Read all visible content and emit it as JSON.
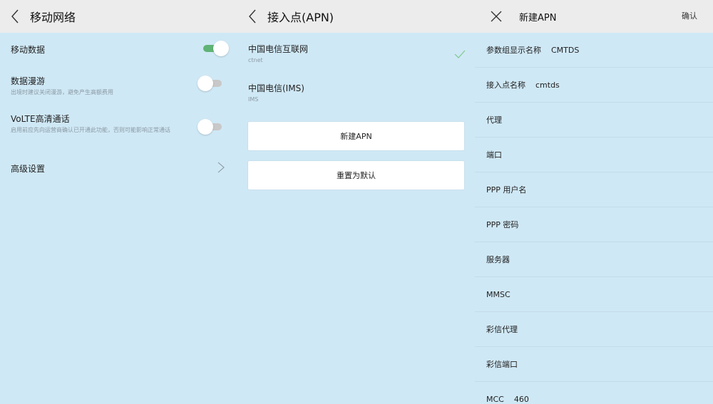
{
  "mobile_network": {
    "title": "移动网络",
    "rows": [
      {
        "title": "移动数据",
        "subtitle": "",
        "control": "toggle",
        "on": true
      },
      {
        "title": "数据漫游",
        "subtitle": "出境时建议关闭漫游，避免产生高额费用",
        "control": "toggle",
        "on": false
      },
      {
        "title": "VoLTE高清通话",
        "subtitle": "启用前应先向运营商确认已开通此功能，否则可能影响正常通话",
        "control": "toggle",
        "on": false
      },
      {
        "title": "高级设置",
        "subtitle": "",
        "control": "chevron"
      }
    ]
  },
  "apn": {
    "title": "接入点(APN)",
    "items": [
      {
        "name": "中国电信互联网",
        "id": "ctnet",
        "selected": true
      },
      {
        "name": "中国电信(IMS)",
        "id": "IMS",
        "selected": false
      }
    ],
    "new_button": "新建APN",
    "reset_button": "重置为默认"
  },
  "new_apn": {
    "title": "新建APN",
    "confirm_label": "确认",
    "fields": [
      {
        "label": "参数组显示名称",
        "value": "CMTDS"
      },
      {
        "label": "接入点名称",
        "value": "cmtds"
      },
      {
        "label": "代理",
        "value": ""
      },
      {
        "label": "端口",
        "value": ""
      },
      {
        "label": "PPP 用户名",
        "value": ""
      },
      {
        "label": "PPP 密码",
        "value": ""
      },
      {
        "label": "服务器",
        "value": ""
      },
      {
        "label": "MMSC",
        "value": ""
      },
      {
        "label": "彩信代理",
        "value": ""
      },
      {
        "label": "彩信端口",
        "value": ""
      },
      {
        "label": "MCC",
        "value": "460"
      }
    ]
  },
  "colors": {
    "background": "#cfe8f5",
    "header": "#ececec",
    "toggle_on": "#5fb375",
    "toggle_off": "#c8c8c8",
    "check": "#7cc98f"
  }
}
